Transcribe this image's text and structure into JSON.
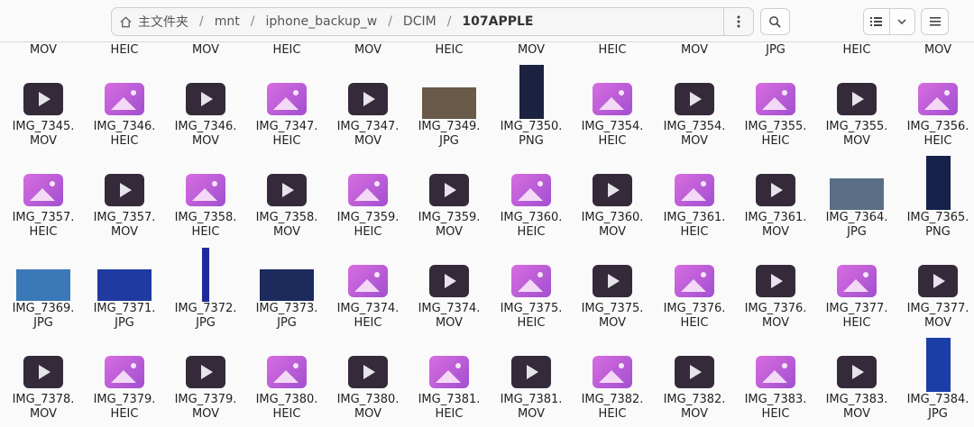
{
  "toolbar": {
    "path": [
      "主文件夹",
      "mnt",
      "iphone_backup_w",
      "DCIM",
      "107APPLE"
    ],
    "more_icon": "vertical-ellipsis-icon",
    "search_icon": "search-icon",
    "view_icon": "list-view-icon",
    "view_dropdown_icon": "chevron-down-icon",
    "menu_icon": "hamburger-menu-icon"
  },
  "columns_x": [
    48,
    138,
    228,
    318,
    408,
    498,
    589,
    679,
    770,
    860,
    950,
    1040
  ],
  "top_row_exts": [
    "MOV",
    "HEIC",
    "MOV",
    "HEIC",
    "MOV",
    "HEIC",
    "MOV",
    "HEIC",
    "MOV",
    "JPG",
    "HEIC",
    "MOV"
  ],
  "rows": [
    [
      {
        "name": "IMG_7345.",
        "ext": "MOV",
        "kind": "video"
      },
      {
        "name": "IMG_7346.",
        "ext": "HEIC",
        "kind": "image"
      },
      {
        "name": "IMG_7346.",
        "ext": "MOV",
        "kind": "video"
      },
      {
        "name": "IMG_7347.",
        "ext": "HEIC",
        "kind": "image"
      },
      {
        "name": "IMG_7347.",
        "ext": "MOV",
        "kind": "video"
      },
      {
        "name": "IMG_7349.",
        "ext": "JPG",
        "kind": "photo",
        "color": "#6a5a4a",
        "shape": "landscape"
      },
      {
        "name": "IMG_7350.",
        "ext": "PNG",
        "kind": "photo",
        "color": "#1b2340",
        "shape": "portrait"
      },
      {
        "name": "IMG_7354.",
        "ext": "HEIC",
        "kind": "image"
      },
      {
        "name": "IMG_7354.",
        "ext": "MOV",
        "kind": "video"
      },
      {
        "name": "IMG_7355.",
        "ext": "HEIC",
        "kind": "image"
      },
      {
        "name": "IMG_7355.",
        "ext": "MOV",
        "kind": "video"
      },
      {
        "name": "IMG_7356.",
        "ext": "HEIC",
        "kind": "image"
      }
    ],
    [
      {
        "name": "IMG_7357.",
        "ext": "HEIC",
        "kind": "image"
      },
      {
        "name": "IMG_7357.",
        "ext": "MOV",
        "kind": "video"
      },
      {
        "name": "IMG_7358.",
        "ext": "HEIC",
        "kind": "image"
      },
      {
        "name": "IMG_7358.",
        "ext": "MOV",
        "kind": "video"
      },
      {
        "name": "IMG_7359.",
        "ext": "HEIC",
        "kind": "image"
      },
      {
        "name": "IMG_7359.",
        "ext": "MOV",
        "kind": "video"
      },
      {
        "name": "IMG_7360.",
        "ext": "HEIC",
        "kind": "image"
      },
      {
        "name": "IMG_7360.",
        "ext": "MOV",
        "kind": "video"
      },
      {
        "name": "IMG_7361.",
        "ext": "HEIC",
        "kind": "image"
      },
      {
        "name": "IMG_7361.",
        "ext": "MOV",
        "kind": "video"
      },
      {
        "name": "IMG_7364.",
        "ext": "JPG",
        "kind": "photo",
        "color": "#5a6e86",
        "shape": "landscape"
      },
      {
        "name": "IMG_7365.",
        "ext": "PNG",
        "kind": "photo",
        "color": "#16224a",
        "shape": "portrait"
      }
    ],
    [
      {
        "name": "IMG_7369.",
        "ext": "JPG",
        "kind": "photo",
        "color": "#3a78b8",
        "shape": "landscape"
      },
      {
        "name": "IMG_7371.",
        "ext": "JPG",
        "kind": "photo",
        "color": "#1f3aa0",
        "shape": "landscape"
      },
      {
        "name": "IMG_7372.",
        "ext": "JPG",
        "kind": "photo",
        "color": "#1e2a9a",
        "shape": "tall"
      },
      {
        "name": "IMG_7373.",
        "ext": "JPG",
        "kind": "photo",
        "color": "#1c2a5c",
        "shape": "landscape"
      },
      {
        "name": "IMG_7374.",
        "ext": "HEIC",
        "kind": "image"
      },
      {
        "name": "IMG_7374.",
        "ext": "MOV",
        "kind": "video"
      },
      {
        "name": "IMG_7375.",
        "ext": "HEIC",
        "kind": "image"
      },
      {
        "name": "IMG_7375.",
        "ext": "MOV",
        "kind": "video"
      },
      {
        "name": "IMG_7376.",
        "ext": "HEIC",
        "kind": "image"
      },
      {
        "name": "IMG_7376.",
        "ext": "MOV",
        "kind": "video"
      },
      {
        "name": "IMG_7377.",
        "ext": "HEIC",
        "kind": "image"
      },
      {
        "name": "IMG_7377.",
        "ext": "MOV",
        "kind": "video"
      }
    ],
    [
      {
        "name": "IMG_7378.",
        "ext": "MOV",
        "kind": "video"
      },
      {
        "name": "IMG_7379.",
        "ext": "HEIC",
        "kind": "image"
      },
      {
        "name": "IMG_7379.",
        "ext": "MOV",
        "kind": "video"
      },
      {
        "name": "IMG_7380.",
        "ext": "HEIC",
        "kind": "image"
      },
      {
        "name": "IMG_7380.",
        "ext": "MOV",
        "kind": "video"
      },
      {
        "name": "IMG_7381.",
        "ext": "HEIC",
        "kind": "image"
      },
      {
        "name": "IMG_7381.",
        "ext": "MOV",
        "kind": "video"
      },
      {
        "name": "IMG_7382.",
        "ext": "HEIC",
        "kind": "image"
      },
      {
        "name": "IMG_7382.",
        "ext": "MOV",
        "kind": "video"
      },
      {
        "name": "IMG_7383.",
        "ext": "HEIC",
        "kind": "image"
      },
      {
        "name": "IMG_7383.",
        "ext": "MOV",
        "kind": "video"
      },
      {
        "name": "IMG_7384.",
        "ext": "JPG",
        "kind": "photo",
        "color": "#1a3ea8",
        "shape": "portrait"
      }
    ]
  ]
}
